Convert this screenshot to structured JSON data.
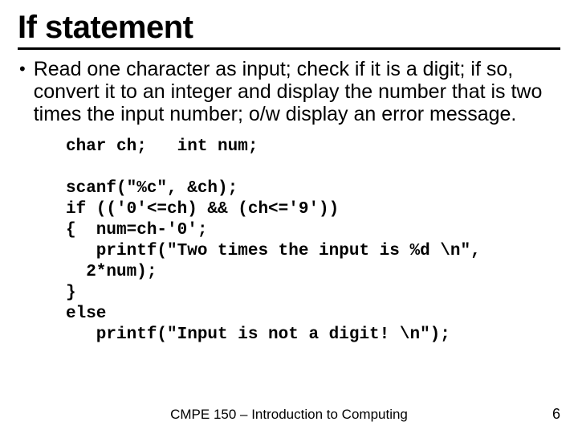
{
  "title": "If statement",
  "bullet": "Read one character as input; check if it is a digit; if so, convert it to an integer and display the number that is two times the input number; o/w display an error message.",
  "code": "char ch;   int num;\n\nscanf(\"%c\", &ch);\nif (('0'<=ch) && (ch<='9'))\n{  num=ch-'0';\n   printf(\"Two times the input is %d \\n\",\n  2*num);\n}\nelse\n   printf(\"Input is not a digit! \\n\");",
  "footer": "CMPE 150 – Introduction to Computing",
  "page": "6"
}
